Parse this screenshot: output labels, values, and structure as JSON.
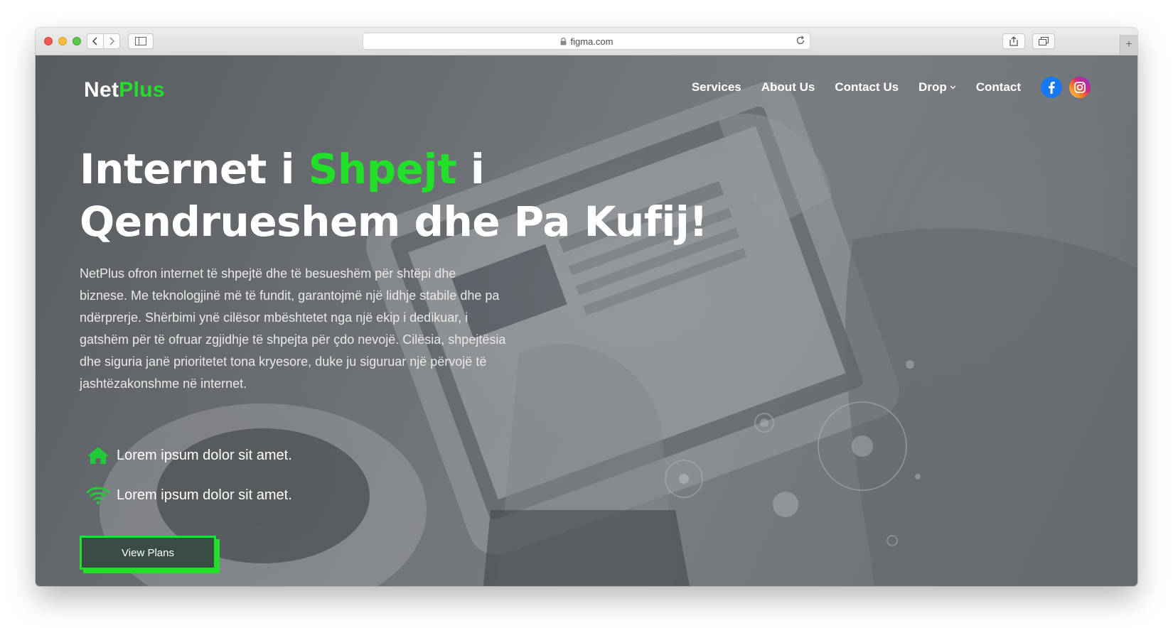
{
  "browser": {
    "url": "figma.com"
  },
  "site": {
    "logo": {
      "part1": "Net",
      "part2": "Plus"
    },
    "nav": {
      "services": "Services",
      "about": "About Us",
      "contact_us": "Contact Us",
      "drop": "Drop",
      "contact": "Contact"
    }
  },
  "hero": {
    "headline_part1": "Internet i ",
    "headline_accent": "Shpejt",
    "headline_part2": " i",
    "headline_line2": "Qendrueshem dhe Pa Kufij!",
    "description": "NetPlus ofron internet të shpejtë dhe të besueshëm për shtëpi dhe biznese. Me teknologjinë më të fundit, garantojmë një lidhje stabile dhe pa ndërprerje. Shërbimi ynë cilësor mbështetet nga një ekip i dedikuar, i gatshëm për të ofruar zgjidhje të shpejta për çdo nevojë. Cilësia, shpejtësia dhe siguria janë prioritetet tona kryesore, duke ju siguruar një përvojë të jashtëzakonshme në internet.",
    "features": [
      {
        "icon": "home-icon",
        "text": "Lorem ipsum dolor sit amet."
      },
      {
        "icon": "wifi-icon",
        "text": "Lorem ipsum dolor sit amet."
      }
    ],
    "cta": "View Plans"
  },
  "colors": {
    "accent": "#22e02a",
    "facebook": "#1877f2",
    "instagram": "#e1306c"
  }
}
